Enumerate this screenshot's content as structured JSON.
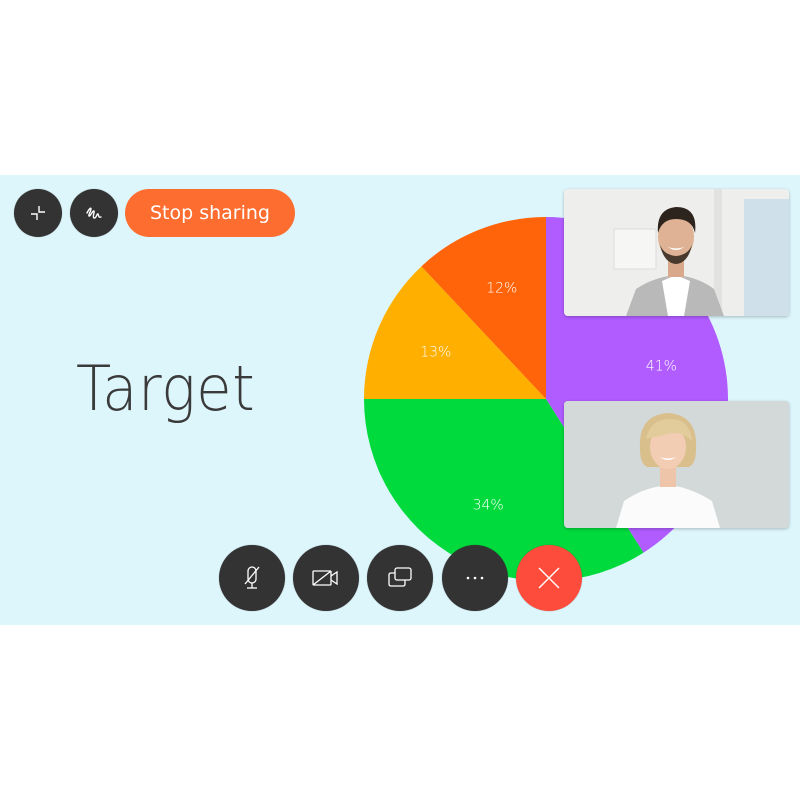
{
  "toolbar_top": {
    "minimize_icon": "minimize-arrows-icon",
    "annotate_icon": "annotate-squiggle-icon",
    "stop_sharing_label": "Stop sharing"
  },
  "slide": {
    "title": "Target"
  },
  "chart_data": {
    "type": "pie",
    "title": "",
    "start": "12 o'clock, clockwise",
    "slices": [
      {
        "label": "41%",
        "value": 41,
        "color": "#b05cff"
      },
      {
        "label": "34%",
        "value": 34,
        "color": "#00da3c"
      },
      {
        "label": "13%",
        "value": 13,
        "color": "#ffaf00"
      },
      {
        "label": "12%",
        "value": 12,
        "color": "#ff640a"
      }
    ]
  },
  "participants": [
    {
      "name": "participant-man",
      "description": "Smiling man in grey blazer"
    },
    {
      "name": "participant-woman",
      "description": "Smiling blonde woman in white blouse"
    }
  ],
  "call_controls": [
    {
      "name": "mute-microphone-button",
      "icon": "microphone-muted-icon"
    },
    {
      "name": "stop-video-button",
      "icon": "video-off-icon"
    },
    {
      "name": "share-screen-button",
      "icon": "screens-icon"
    },
    {
      "name": "more-options-button",
      "icon": "more-dots-icon"
    },
    {
      "name": "end-call-button",
      "icon": "close-x-icon"
    }
  ],
  "colors": {
    "stage_bg": "#ddf6fc",
    "button_dark": "#333333",
    "stop_sharing": "#fd6d2f",
    "end_call": "#fd4c3c"
  }
}
